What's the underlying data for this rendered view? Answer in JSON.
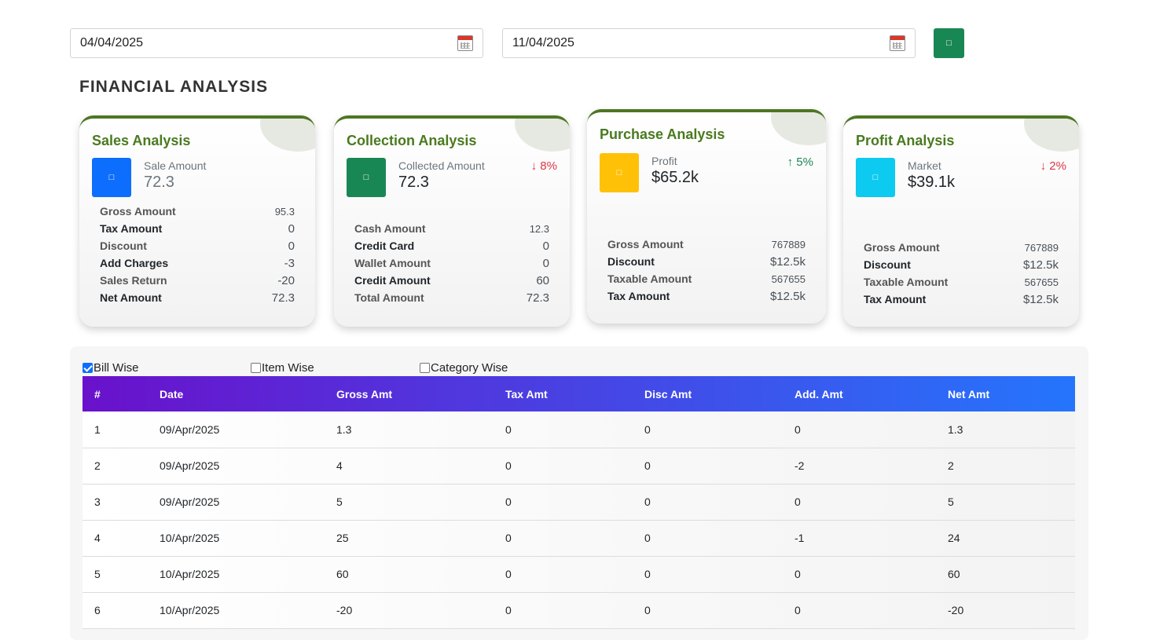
{
  "filters": {
    "from_date": "04/04/2025",
    "to_date": "11/04/2025",
    "submit_icon": "□"
  },
  "page_title": "FINANCIAL ANALYSIS",
  "cards": {
    "sales": {
      "title": "Sales Analysis",
      "icon": "□",
      "icon_color": "#0d6efd",
      "metric_label": "Sale Amount",
      "metric_value": "72.3",
      "rows": [
        {
          "label": "Gross Amount",
          "value": "95.3"
        },
        {
          "label": "Tax Amount",
          "value": "0"
        },
        {
          "label": "Discount",
          "value": "0"
        },
        {
          "label": "Add Charges",
          "value": "-3"
        },
        {
          "label": "Sales Return",
          "value": "-20"
        },
        {
          "label": "Net Amount",
          "value": "72.3"
        }
      ]
    },
    "collection": {
      "title": "Collection Analysis",
      "icon": "□",
      "icon_color": "#198754",
      "metric_label": "Collected Amount",
      "metric_value": "72.3",
      "trend": "↓ 8%",
      "rows": [
        {
          "label": "Cash Amount",
          "value": "12.3"
        },
        {
          "label": "Credit Card",
          "value": "0"
        },
        {
          "label": "Wallet Amount",
          "value": "0"
        },
        {
          "label": "Credit Amount",
          "value": "60"
        },
        {
          "label": "Total Amount",
          "value": "72.3"
        }
      ]
    },
    "purchase": {
      "title": "Purchase Analysis",
      "icon": "□",
      "icon_color": "#ffc107",
      "metric_label": "Profit",
      "metric_value": "$65.2k",
      "trend": "↑ 5%",
      "rows": [
        {
          "label": "Gross Amount",
          "value": "767889"
        },
        {
          "label": "Discount",
          "value": "$12.5k"
        },
        {
          "label": "Taxable Amount",
          "value": "567655"
        },
        {
          "label": "Tax Amount",
          "value": "$12.5k"
        }
      ]
    },
    "profit": {
      "title": "Profit Analysis",
      "icon": "□",
      "icon_color": "#0dcaf0",
      "metric_label": "Market",
      "metric_value": "$39.1k",
      "trend": "↓ 2%",
      "rows": [
        {
          "label": "Gross Amount",
          "value": "767889"
        },
        {
          "label": "Discount",
          "value": "$12.5k"
        },
        {
          "label": "Taxable Amount",
          "value": "567655"
        },
        {
          "label": "Tax Amount",
          "value": "$12.5k"
        }
      ]
    }
  },
  "view_options": {
    "bill_wise": "Bill Wise",
    "item_wise": "Item Wise",
    "category_wise": "Category Wise",
    "selected": "Bill Wise"
  },
  "table": {
    "headers": [
      "#",
      "Date",
      "Gross Amt",
      "Tax Amt",
      "Disc Amt",
      "Add. Amt",
      "Net Amt"
    ],
    "rows": [
      [
        "1",
        "09/Apr/2025",
        "1.3",
        "0",
        "0",
        "0",
        "1.3"
      ],
      [
        "2",
        "09/Apr/2025",
        "4",
        "0",
        "0",
        "-2",
        "2"
      ],
      [
        "3",
        "09/Apr/2025",
        "5",
        "0",
        "0",
        "0",
        "5"
      ],
      [
        "4",
        "10/Apr/2025",
        "25",
        "0",
        "0",
        "-1",
        "24"
      ],
      [
        "5",
        "10/Apr/2025",
        "60",
        "0",
        "0",
        "0",
        "60"
      ],
      [
        "6",
        "10/Apr/2025",
        "-20",
        "0",
        "0",
        "0",
        "-20"
      ]
    ]
  }
}
